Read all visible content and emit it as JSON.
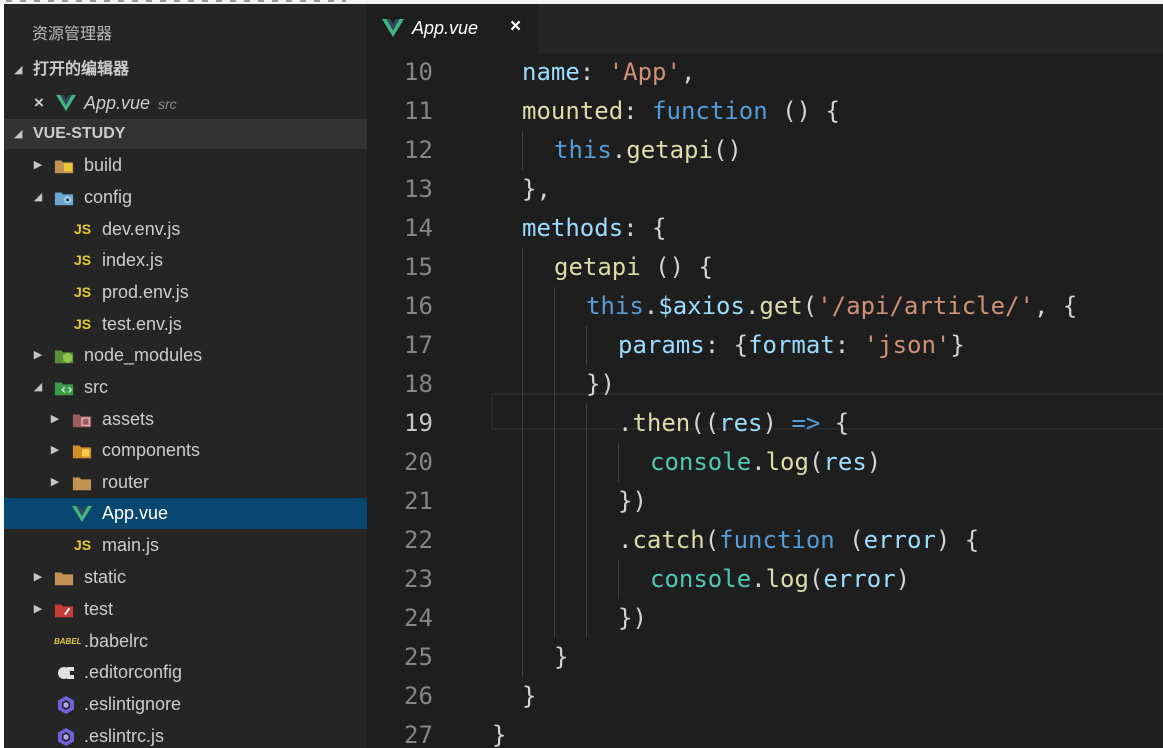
{
  "explorer": {
    "title": "资源管理器",
    "open_editors": {
      "label": "打开的编辑器",
      "files": [
        {
          "name": "App.vue",
          "dir": "src"
        }
      ]
    },
    "project": {
      "label": "VUE-STUDY"
    },
    "tree": [
      {
        "name": "build",
        "icon": "folder-build-icon",
        "twisty": "▶"
      },
      {
        "name": "config",
        "icon": "folder-config-icon",
        "twisty": "◢"
      },
      {
        "name": "dev.env.js",
        "icon": "JS"
      },
      {
        "name": "index.js",
        "icon": "JS"
      },
      {
        "name": "prod.env.js",
        "icon": "JS"
      },
      {
        "name": "test.env.js",
        "icon": "JS"
      },
      {
        "name": "node_modules",
        "icon": "folder-node-icon",
        "twisty": "▶"
      },
      {
        "name": "src",
        "icon": "folder-src-icon",
        "twisty": "◢"
      },
      {
        "name": "assets",
        "icon": "folder-assets-icon",
        "twisty": "▶"
      },
      {
        "name": "components",
        "icon": "folder-components-icon",
        "twisty": "▶"
      },
      {
        "name": "router",
        "icon": "folder-icon",
        "twisty": "▶"
      },
      {
        "name": "App.vue",
        "icon": "vue-icon",
        "selected": true
      },
      {
        "name": "main.js",
        "icon": "JS"
      },
      {
        "name": "static",
        "icon": "folder-icon",
        "twisty": "▶"
      },
      {
        "name": "test",
        "icon": "folder-test-icon",
        "twisty": "▶"
      },
      {
        "name": ".babelrc",
        "icon": "BABEL"
      },
      {
        "name": ".editorconfig",
        "icon": "editorconfig-icon"
      },
      {
        "name": ".eslintignore",
        "icon": "eslint-icon"
      },
      {
        "name": ".eslintrc.js",
        "icon": "eslint-icon"
      }
    ]
  },
  "editor": {
    "active_tab": "App.vue",
    "close_glyph": "×",
    "current_line": "19",
    "line_numbers": [
      "10",
      "11",
      "12",
      "13",
      "14",
      "15",
      "16",
      "17",
      "18",
      "19",
      "20",
      "21",
      "22",
      "23",
      "24",
      "25",
      "26",
      "27"
    ]
  },
  "colors": {
    "keyword": "#569cd6",
    "string": "#ce9178",
    "property": "#9cdcfe",
    "function": "#dcdcaa",
    "selection": "#094771",
    "vue_green": "#41b883",
    "js_yellow": "#e8c834"
  }
}
